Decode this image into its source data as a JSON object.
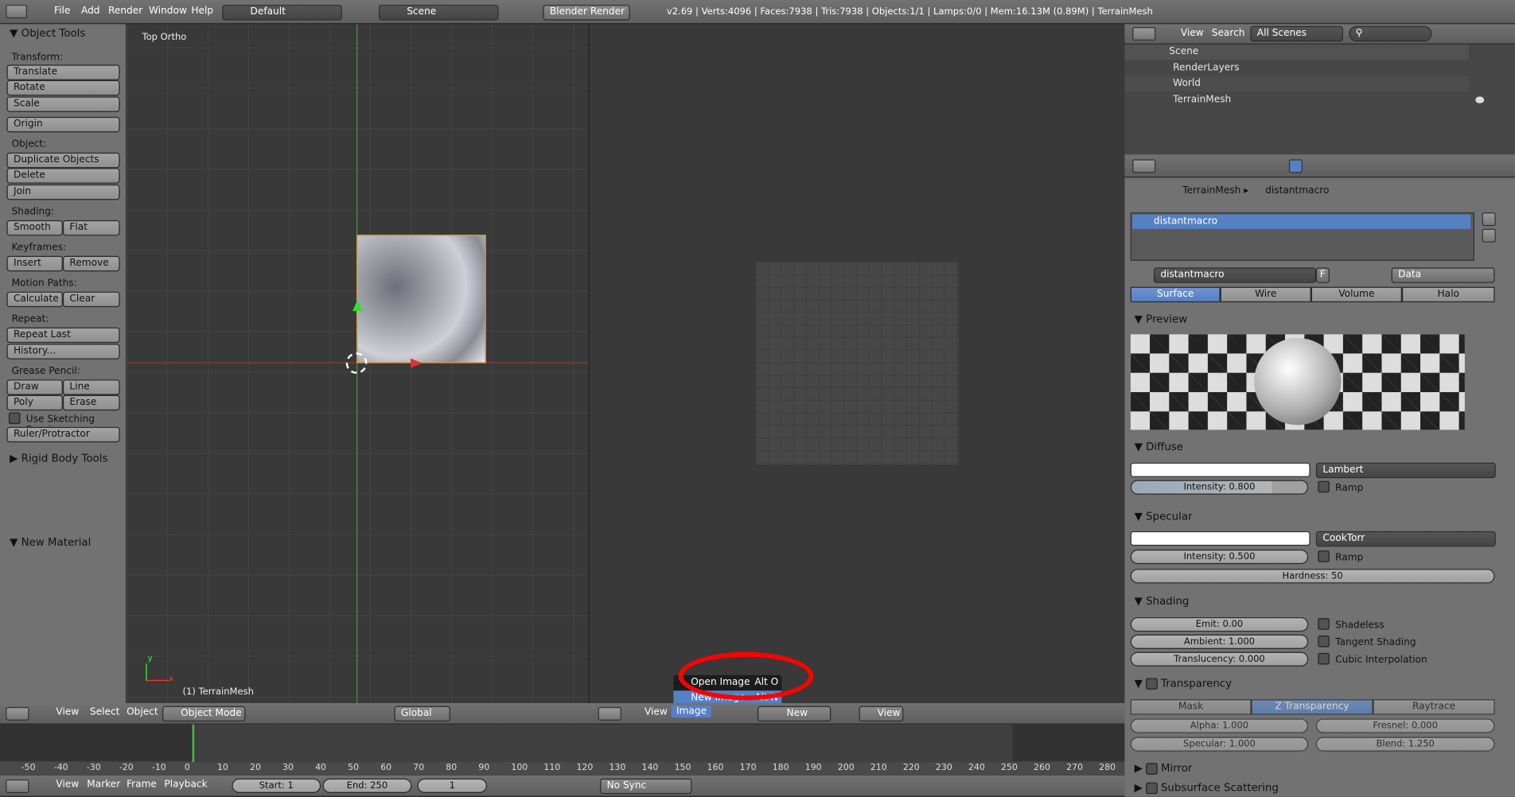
{
  "topbar": {
    "menus": [
      "File",
      "Add",
      "Render",
      "Window",
      "Help"
    ],
    "layout": "Default",
    "scene": "Scene",
    "engine": "Blender Render",
    "status": "v2.69 | Verts:4096 | Faces:7938 | Tris:7938 | Objects:1/1 | Lamps:0/0 | Mem:16.13M (0.89M) | TerrainMesh"
  },
  "tools": {
    "title": "Object Tools",
    "transform_label": "Transform:",
    "translate": "Translate",
    "rotate": "Rotate",
    "scale": "Scale",
    "origin": "Origin",
    "object_label": "Object:",
    "duplicate": "Duplicate Objects",
    "delete": "Delete",
    "join": "Join",
    "shading_label": "Shading:",
    "smooth": "Smooth",
    "flat": "Flat",
    "keyframes_label": "Keyframes:",
    "insert": "Insert",
    "remove": "Remove",
    "motion_label": "Motion Paths:",
    "calculate": "Calculate",
    "clear": "Clear",
    "repeat_label": "Repeat:",
    "repeat_last": "Repeat Last",
    "history": "History...",
    "grease_label": "Grease Pencil:",
    "draw": "Draw",
    "line": "Line",
    "poly": "Poly",
    "erase": "Erase",
    "sketch": "Use Sketching Sessions",
    "ruler": "Ruler/Protractor",
    "rigid": "Rigid Body Tools",
    "new_material": "New Material"
  },
  "viewport": {
    "view_name": "Top Ortho",
    "object_name": "(1) TerrainMesh",
    "axis_y": "y",
    "axis_x": "x",
    "menus": [
      "View",
      "Select",
      "Object"
    ],
    "mode": "Object Mode",
    "orientation": "Global"
  },
  "image_editor": {
    "menus": [
      "View",
      "Image"
    ],
    "new_label": "New",
    "view_label": "View",
    "popup": {
      "open": "Open Image",
      "shortcut": "Alt O",
      "new": "New Image",
      "new_shortcut": "Alt N"
    }
  },
  "timeline": {
    "ticks": [
      "-50",
      "-40",
      "-30",
      "-20",
      "-10",
      "0",
      "10",
      "20",
      "30",
      "40",
      "50",
      "60",
      "70",
      "80",
      "90",
      "100",
      "110",
      "120",
      "130",
      "140",
      "150",
      "160",
      "170",
      "180",
      "190",
      "200",
      "210",
      "220",
      "230",
      "240",
      "250",
      "260",
      "270",
      "280"
    ],
    "menus": [
      "View",
      "Marker",
      "Frame",
      "Playback"
    ],
    "start": "Start: 1",
    "end": "End: 250",
    "frame": "1",
    "sync": "No Sync"
  },
  "outliner": {
    "menus": [
      "View",
      "Search"
    ],
    "filter": "All Scenes",
    "tree": [
      "Scene",
      "RenderLayers",
      "World",
      "TerrainMesh"
    ]
  },
  "props": {
    "breadcrumb": [
      "TerrainMesh",
      "distantmacro"
    ],
    "slot": "distantmacro",
    "material_name": "distantmacro",
    "f": "F",
    "data": "Data",
    "tabs": [
      "Surface",
      "Wire",
      "Volume",
      "Halo"
    ],
    "preview": "Preview",
    "diffuse": {
      "title": "Diffuse",
      "shader": "Lambert",
      "intensity": "Intensity: 0.800",
      "ramp": "Ramp"
    },
    "specular": {
      "title": "Specular",
      "shader": "CookTorr",
      "intensity": "Intensity: 0.500",
      "ramp": "Ramp",
      "hardness": "Hardness: 50"
    },
    "shading": {
      "title": "Shading",
      "emit": "Emit: 0.00",
      "ambient": "Ambient: 1.000",
      "translucency": "Translucency: 0.000",
      "shadeless": "Shadeless",
      "tangent": "Tangent Shading",
      "cubic": "Cubic Interpolation"
    },
    "transparency": {
      "title": "Transparency",
      "tabs": [
        "Mask",
        "Z Transparency",
        "Raytrace"
      ],
      "alpha": "Alpha: 1.000",
      "fresnel": "Fresnel: 0.000",
      "specular": "Specular: 1.000",
      "blend": "Blend: 1.250"
    },
    "mirror": "Mirror",
    "sss": "Subsurface Scattering"
  }
}
